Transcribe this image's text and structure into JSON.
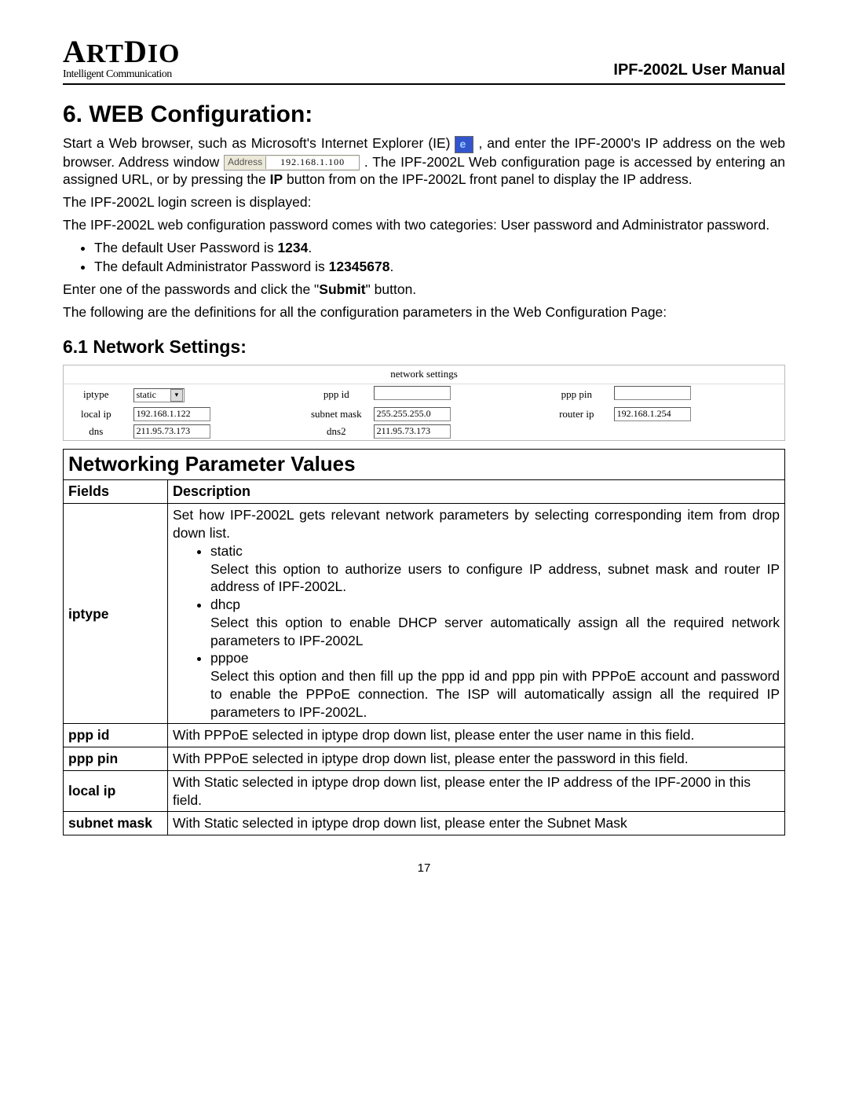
{
  "header": {
    "logo_main": "ARTDIO",
    "logo_sub": "Intelligent Communication",
    "manual": "IPF-2002L User Manual"
  },
  "title": "6.  WEB Configuration:",
  "intro": {
    "p1a": "Start a Web browser, such as Microsoft's Internet Explorer (IE) ",
    "p1b": ", and enter the IPF-2000's IP address on the web browser. Address window ",
    "addr_label": "Address",
    "addr_value": "192.168.1.100",
    "p1c": ". The IPF-2002L Web configuration page is accessed by entering an assigned URL, or by pressing the ",
    "p1c_bold": "IP",
    "p1c_tail": " button from on the IPF-2002L front panel to display the IP address.",
    "p2": "The IPF-2002L login screen is displayed:",
    "p3": "The IPF-2002L web configuration password comes with two categories: User password and Administrator password.",
    "b1_a": "The default User Password is ",
    "b1_b": "1234",
    "b1_c": ".",
    "b2_a": "The default Administrator Password is ",
    "b2_b": "12345678",
    "b2_c": ".",
    "p4a": "Enter one of the passwords and click the \"",
    "p4b": "Submit",
    "p4c": "\" button.",
    "p5": "The following are the definitions for all the configuration parameters in the Web Configuration Page:"
  },
  "subsection": "6.1 Network Settings:",
  "netbox": {
    "title": "network settings",
    "rows": [
      {
        "l1": "iptype",
        "v1": "static",
        "sel": true,
        "l2": "ppp id",
        "v2": "",
        "l3": "ppp pin",
        "v3": ""
      },
      {
        "l1": "local ip",
        "v1": "192.168.1.122",
        "l2": "subnet mask",
        "v2": "255.255.255.0",
        "l3": "router ip",
        "v3": "192.168.1.254"
      },
      {
        "l1": "dns",
        "v1": "211.95.73.173",
        "l2": "dns2",
        "v2": "211.95.73.173",
        "l3": "",
        "v3": ""
      }
    ]
  },
  "pvtitle": "Networking Parameter Values",
  "pvhead": {
    "f": "Fields",
    "d": "Description"
  },
  "pv": [
    {
      "field": "iptype",
      "lead": "Set how IPF-2002L gets relevant network parameters by selecting corresponding item from drop down list.",
      "opts": [
        {
          "name": "static",
          "desc": "Select this option to authorize users to configure IP address, subnet mask and router IP address of IPF-2002L."
        },
        {
          "name": "dhcp",
          "desc": "Select this option to enable DHCP server automatically assign all the required network parameters to IPF-2002L"
        },
        {
          "name": "pppoe",
          "desc": "Select this option and then fill up the ppp id and ppp pin with PPPoE account and password to enable the PPPoE connection. The ISP will automatically assign all the required IP parameters to IPF-2002L."
        }
      ]
    },
    {
      "field": "ppp id",
      "desc": "With PPPoE selected in iptype drop down list, please enter the user name in this field."
    },
    {
      "field": "ppp pin",
      "desc": "With PPPoE selected in iptype drop down list, please enter the password in this field."
    },
    {
      "field": "local ip",
      "desc": "With Static selected in iptype drop down list, please enter the IP address of the IPF-2000 in this field."
    },
    {
      "field": "subnet mask",
      "desc": "With Static selected in iptype drop down list, please enter the Subnet Mask"
    }
  ],
  "page_no": "17"
}
